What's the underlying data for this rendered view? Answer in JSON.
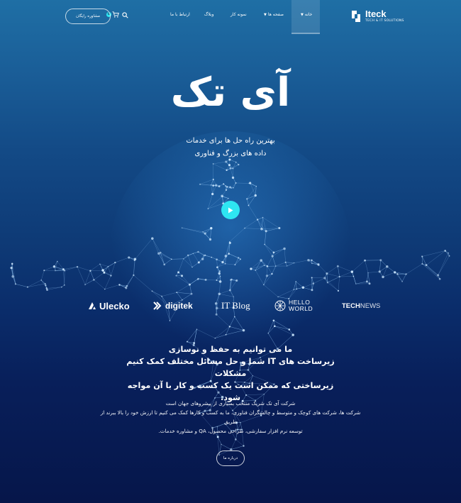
{
  "brand": {
    "name": "Iteck",
    "tagline": "TECH & IT SOLUTIONS",
    "accent_color": "#2ee6f2"
  },
  "nav": {
    "items": [
      {
        "label": "خانه",
        "has_dropdown": true,
        "active": true
      },
      {
        "label": "صفحه ها",
        "has_dropdown": true,
        "active": false
      },
      {
        "label": "نمونه کار",
        "has_dropdown": false,
        "active": false
      },
      {
        "label": "وبلاگ",
        "has_dropdown": false,
        "active": false
      },
      {
        "label": "ارتباط با ما",
        "has_dropdown": false,
        "active": false
      }
    ],
    "cart_count": "0",
    "cta_label": "مشاوره رایگان"
  },
  "hero": {
    "title": "آی تک",
    "subtitle_line1": "بهترین راه حل ها برای خدمات",
    "subtitle_line2": "داده های بزرگ و فناوری"
  },
  "brands": [
    "Ulecko",
    "digitek",
    "IT Blog",
    "HELLO",
    "WORLD",
    "TECH",
    "NEWS"
  ],
  "intro": {
    "headline_line1": "ما می توانیم به حفظ و نوسازی",
    "headline_line2": "زیرساخت های IT شما و حل مسائل مختلف کمک کنیم مشکلات",
    "headline_line3": "زیرساختی که ممکن است یک کسب و کار با آن مواجه شود.",
    "para_line1": "شرکت آی تک شریک منتخب بسیاری از پیشروهای جهان است",
    "para_line2": "شرکت ها، شرکت های کوچک و متوسط و چالشگران فناوری، ما به کسب و کارها کمک می کنیم تا ارزش خود را بالا ببرند از طریق",
    "para_line3": "توسعه نرم افزار سفارشی، طراحی محصول، QA و مشاوره خدمات.",
    "button_label": "درباره ما"
  }
}
